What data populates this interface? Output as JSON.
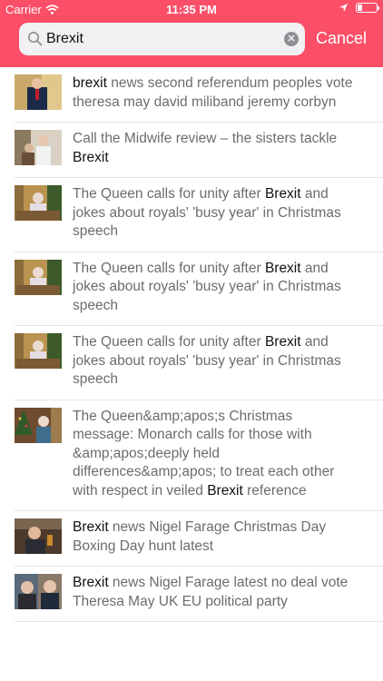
{
  "status_bar": {
    "carrier": "Carrier",
    "time": "11:35 PM"
  },
  "search": {
    "query": "Brexit",
    "cancel_label": "Cancel"
  },
  "colors": {
    "accent": "#fb4f68",
    "highlight_text": "#111111",
    "body_text": "#6c6c6c"
  },
  "results": [
    {
      "thumb": "bg-politics-portrait",
      "parts": [
        [
          "brexit",
          true
        ],
        [
          " news second referendum peoples vote theresa may david miliband jeremy corbyn",
          false
        ]
      ]
    },
    {
      "thumb": "bg-midwife-drama",
      "parts": [
        [
          "Call the Midwife review – the sisters tackle ",
          false
        ],
        [
          "Brexit",
          true
        ]
      ]
    },
    {
      "thumb": "bg-queen-speech",
      "parts": [
        [
          "The Queen calls for unity after ",
          false
        ],
        [
          "Brexit",
          true
        ],
        [
          " and jokes about royals' 'busy year' in Christmas speech",
          false
        ]
      ]
    },
    {
      "thumb": "bg-queen-speech",
      "parts": [
        [
          "The Queen calls for unity after ",
          false
        ],
        [
          "Brexit",
          true
        ],
        [
          " and jokes about royals' 'busy year' in Christmas speech",
          false
        ]
      ]
    },
    {
      "thumb": "bg-queen-speech",
      "parts": [
        [
          "The Queen calls for unity after ",
          false
        ],
        [
          "Brexit",
          true
        ],
        [
          " and jokes about royals' 'busy year' in Christmas speech",
          false
        ]
      ]
    },
    {
      "thumb": "bg-queen-tree",
      "parts": [
        [
          "The Queen&amp;apos;s Christmas message: Monarch calls for those with &amp;apos;deeply held differences&amp;apos; to treat each other with respect in veiled ",
          false
        ],
        [
          "Brexit",
          true
        ],
        [
          " reference",
          false
        ]
      ]
    },
    {
      "thumb": "bg-farage-pub",
      "parts": [
        [
          "Brexit",
          true
        ],
        [
          " news Nigel Farage Christmas Day Boxing Day hunt latest",
          false
        ]
      ]
    },
    {
      "thumb": "bg-may-farage",
      "parts": [
        [
          "Brexit",
          true
        ],
        [
          " news Nigel Farage latest no deal vote Theresa May UK EU political party",
          false
        ]
      ]
    }
  ]
}
